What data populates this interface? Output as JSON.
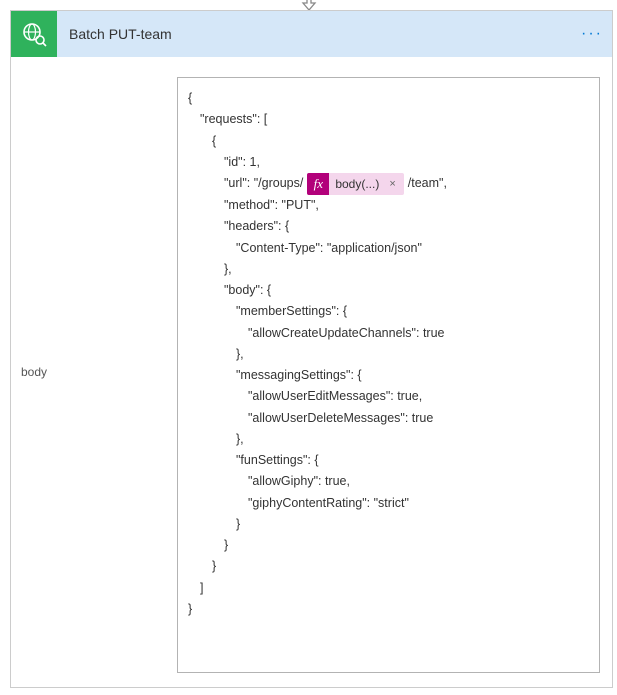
{
  "header": {
    "title": "Batch PUT-team",
    "icon": "globe-search-icon",
    "menu": "···"
  },
  "param": {
    "label": "body"
  },
  "code": {
    "l0": "{",
    "l1": "\"requests\": [",
    "l2": "{",
    "l3": "\"id\": 1,",
    "l4_pre": "\"url\": \"/groups/",
    "l4_post": "/team\",",
    "l5": "\"method\": \"PUT\",",
    "l6": "\"headers\": {",
    "l7": "\"Content-Type\": \"application/json\"",
    "l8": "},",
    "l9": "\"body\": {",
    "l10": "\"memberSettings\": {",
    "l11": "\"allowCreateUpdateChannels\": true",
    "l12": "},",
    "l13": "\"messagingSettings\": {",
    "l14": "\"allowUserEditMessages\": true,",
    "l15": "\"allowUserDeleteMessages\": true",
    "l16": "},",
    "l17": "\"funSettings\": {",
    "l18": "\"allowGiphy\": true,",
    "l19": "\"giphyContentRating\": \"strict\"",
    "l20": "}",
    "l21": "}",
    "l22": "}",
    "l23": "]",
    "l24": "}"
  },
  "token": {
    "fx": "fx",
    "label": "body(...)",
    "remove": "×"
  }
}
